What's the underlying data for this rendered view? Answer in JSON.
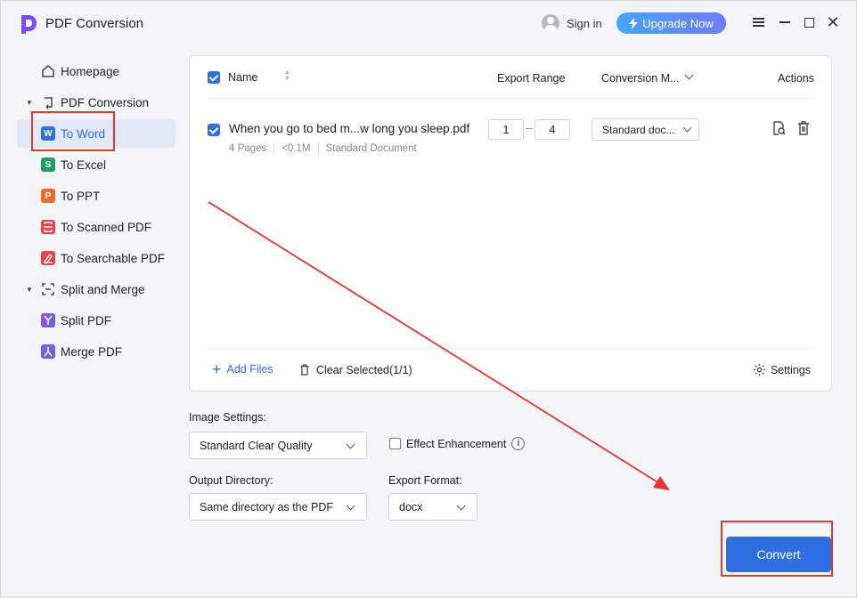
{
  "app": {
    "title": "PDF Conversion"
  },
  "header": {
    "signin_label": "Sign in",
    "upgrade_label": "Upgrade Now"
  },
  "sidebar": {
    "homepage": "Homepage",
    "group1": "PDF Conversion",
    "to_word": "To Word",
    "to_excel": "To Excel",
    "to_ppt": "To PPT",
    "to_scanned": "To Scanned PDF",
    "to_searchable": "To Searchable PDF",
    "group2": "Split and Merge",
    "split_pdf": "Split PDF",
    "merge_pdf": "Merge PDF",
    "icon_letters": {
      "word": "W",
      "excel": "S",
      "ppt": "P"
    },
    "icon_colors": {
      "word": "#2f6fe4",
      "excel": "#1f9d62",
      "ppt": "#f06a2b",
      "scanned": "#e8434a",
      "searchable": "#e8434a",
      "split": "#7c5ce0",
      "merge": "#7c5ce0"
    }
  },
  "table": {
    "col_name": "Name",
    "col_range": "Export Range",
    "col_mode": "Conversion M...",
    "col_actions": "Actions",
    "file": {
      "name": "When you go to bed m...w long you sleep.pdf",
      "pages": "4 Pages",
      "size": "<0.1M",
      "type": "Standard Document",
      "range_from": "1",
      "range_to": "4",
      "mode": "Standard doc..."
    }
  },
  "footer": {
    "add_files": "Add Files",
    "clear_selected": "Clear Selected(1/1)",
    "settings": "Settings"
  },
  "options": {
    "image_settings_label": "Image Settings:",
    "image_quality": "Standard Clear Quality",
    "effect_label": "Effect Enhancement",
    "output_dir_label": "Output Directory:",
    "output_dir": "Same directory as the PDF",
    "export_format_label": "Export Format:",
    "export_format": "docx"
  },
  "convert_label": "Convert",
  "colors": {
    "accent": "#2f6fe4",
    "annotation_red": "#e8352d"
  }
}
